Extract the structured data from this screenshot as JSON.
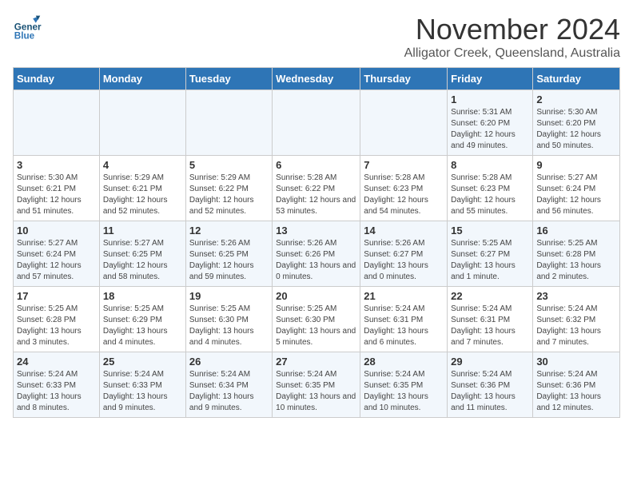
{
  "logo": {
    "line1": "General",
    "line2": "Blue"
  },
  "title": "November 2024",
  "location": "Alligator Creek, Queensland, Australia",
  "weekdays": [
    "Sunday",
    "Monday",
    "Tuesday",
    "Wednesday",
    "Thursday",
    "Friday",
    "Saturday"
  ],
  "weeks": [
    [
      {
        "day": "",
        "info": ""
      },
      {
        "day": "",
        "info": ""
      },
      {
        "day": "",
        "info": ""
      },
      {
        "day": "",
        "info": ""
      },
      {
        "day": "",
        "info": ""
      },
      {
        "day": "1",
        "info": "Sunrise: 5:31 AM\nSunset: 6:20 PM\nDaylight: 12 hours and 49 minutes."
      },
      {
        "day": "2",
        "info": "Sunrise: 5:30 AM\nSunset: 6:20 PM\nDaylight: 12 hours and 50 minutes."
      }
    ],
    [
      {
        "day": "3",
        "info": "Sunrise: 5:30 AM\nSunset: 6:21 PM\nDaylight: 12 hours and 51 minutes."
      },
      {
        "day": "4",
        "info": "Sunrise: 5:29 AM\nSunset: 6:21 PM\nDaylight: 12 hours and 52 minutes."
      },
      {
        "day": "5",
        "info": "Sunrise: 5:29 AM\nSunset: 6:22 PM\nDaylight: 12 hours and 52 minutes."
      },
      {
        "day": "6",
        "info": "Sunrise: 5:28 AM\nSunset: 6:22 PM\nDaylight: 12 hours and 53 minutes."
      },
      {
        "day": "7",
        "info": "Sunrise: 5:28 AM\nSunset: 6:23 PM\nDaylight: 12 hours and 54 minutes."
      },
      {
        "day": "8",
        "info": "Sunrise: 5:28 AM\nSunset: 6:23 PM\nDaylight: 12 hours and 55 minutes."
      },
      {
        "day": "9",
        "info": "Sunrise: 5:27 AM\nSunset: 6:24 PM\nDaylight: 12 hours and 56 minutes."
      }
    ],
    [
      {
        "day": "10",
        "info": "Sunrise: 5:27 AM\nSunset: 6:24 PM\nDaylight: 12 hours and 57 minutes."
      },
      {
        "day": "11",
        "info": "Sunrise: 5:27 AM\nSunset: 6:25 PM\nDaylight: 12 hours and 58 minutes."
      },
      {
        "day": "12",
        "info": "Sunrise: 5:26 AM\nSunset: 6:25 PM\nDaylight: 12 hours and 59 minutes."
      },
      {
        "day": "13",
        "info": "Sunrise: 5:26 AM\nSunset: 6:26 PM\nDaylight: 13 hours and 0 minutes."
      },
      {
        "day": "14",
        "info": "Sunrise: 5:26 AM\nSunset: 6:27 PM\nDaylight: 13 hours and 0 minutes."
      },
      {
        "day": "15",
        "info": "Sunrise: 5:25 AM\nSunset: 6:27 PM\nDaylight: 13 hours and 1 minute."
      },
      {
        "day": "16",
        "info": "Sunrise: 5:25 AM\nSunset: 6:28 PM\nDaylight: 13 hours and 2 minutes."
      }
    ],
    [
      {
        "day": "17",
        "info": "Sunrise: 5:25 AM\nSunset: 6:28 PM\nDaylight: 13 hours and 3 minutes."
      },
      {
        "day": "18",
        "info": "Sunrise: 5:25 AM\nSunset: 6:29 PM\nDaylight: 13 hours and 4 minutes."
      },
      {
        "day": "19",
        "info": "Sunrise: 5:25 AM\nSunset: 6:30 PM\nDaylight: 13 hours and 4 minutes."
      },
      {
        "day": "20",
        "info": "Sunrise: 5:25 AM\nSunset: 6:30 PM\nDaylight: 13 hours and 5 minutes."
      },
      {
        "day": "21",
        "info": "Sunrise: 5:24 AM\nSunset: 6:31 PM\nDaylight: 13 hours and 6 minutes."
      },
      {
        "day": "22",
        "info": "Sunrise: 5:24 AM\nSunset: 6:31 PM\nDaylight: 13 hours and 7 minutes."
      },
      {
        "day": "23",
        "info": "Sunrise: 5:24 AM\nSunset: 6:32 PM\nDaylight: 13 hours and 7 minutes."
      }
    ],
    [
      {
        "day": "24",
        "info": "Sunrise: 5:24 AM\nSunset: 6:33 PM\nDaylight: 13 hours and 8 minutes."
      },
      {
        "day": "25",
        "info": "Sunrise: 5:24 AM\nSunset: 6:33 PM\nDaylight: 13 hours and 9 minutes."
      },
      {
        "day": "26",
        "info": "Sunrise: 5:24 AM\nSunset: 6:34 PM\nDaylight: 13 hours and 9 minutes."
      },
      {
        "day": "27",
        "info": "Sunrise: 5:24 AM\nSunset: 6:35 PM\nDaylight: 13 hours and 10 minutes."
      },
      {
        "day": "28",
        "info": "Sunrise: 5:24 AM\nSunset: 6:35 PM\nDaylight: 13 hours and 10 minutes."
      },
      {
        "day": "29",
        "info": "Sunrise: 5:24 AM\nSunset: 6:36 PM\nDaylight: 13 hours and 11 minutes."
      },
      {
        "day": "30",
        "info": "Sunrise: 5:24 AM\nSunset: 6:36 PM\nDaylight: 13 hours and 12 minutes."
      }
    ]
  ]
}
